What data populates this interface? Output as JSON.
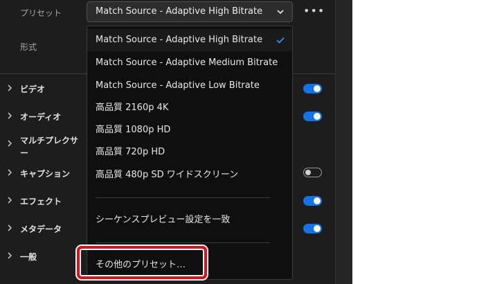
{
  "preset": {
    "label": "プリセット",
    "value": "Match Source - Adaptive High Bitrate",
    "more": "•••"
  },
  "format": {
    "label": "形式"
  },
  "sections": [
    {
      "label": "ビデオ",
      "toggle": "on"
    },
    {
      "label": "オーディオ",
      "toggle": "on"
    },
    {
      "label": "マルチプレクサー",
      "toggle": "none"
    },
    {
      "label": "キャプション",
      "toggle": "off"
    },
    {
      "label": "エフェクト",
      "toggle": "on"
    },
    {
      "label": "メタデータ",
      "toggle": "on"
    },
    {
      "label": "一般",
      "toggle": "none"
    }
  ],
  "dropdown": {
    "items": [
      "Match Source - Adaptive High Bitrate",
      "Match Source - Adaptive Medium Bitrate",
      "Match Source - Adaptive Low Bitrate",
      "高品質 2160p 4K",
      "高品質 1080p HD",
      "高品質 720p HD",
      "高品質 480p SD ワイドスクリーン"
    ],
    "selected_index": 0,
    "sequence_item": "シーケンスプレビュー設定を一致",
    "other_presets": "その他のプリセット…"
  },
  "colors": {
    "accent": "#1473e6",
    "highlight": "#e0101a",
    "panel": "#1d1d1d"
  },
  "icons": {
    "selected": "checkmark-icon",
    "expand": "chevron-right-icon",
    "select": "chevron-down-icon"
  }
}
